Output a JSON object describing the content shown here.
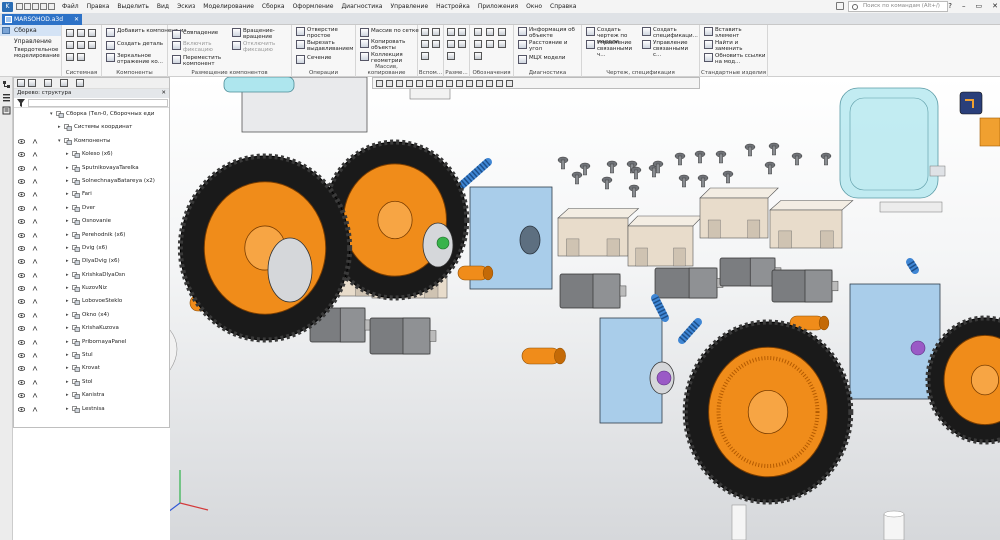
{
  "app": {
    "logo_letter": "K"
  },
  "menu": [
    "Файл",
    "Правка",
    "Выделить",
    "Вид",
    "Эскиз",
    "Моделирование",
    "Сборка",
    "Оформление",
    "Диагностика",
    "Управление",
    "Настройка",
    "Приложения",
    "Окно",
    "Справка"
  ],
  "search": {
    "placeholder": "Поиск по командам (Alt+/)"
  },
  "document_tab": {
    "label": "MARSOHOD.a3d"
  },
  "mode_panel": [
    "Сборка",
    "Управление",
    "Твердотельное моделирование"
  ],
  "ribbon": {
    "groups": [
      {
        "label": "Системная"
      },
      {
        "label": "Компоненты",
        "buttons": [
          "Добавить компонент из...",
          "Создать деталь",
          "Зеркальное отражение ко..."
        ]
      },
      {
        "label": "Размещение компонентов",
        "buttons": [
          "Совпадение",
          "Включить фиксацию",
          "Переместить компонент",
          "Вращение-вращение",
          "Отключить фиксацию"
        ]
      },
      {
        "label": "Операции",
        "buttons": [
          "Отверстие простое",
          "Вырезать выдавливанием",
          "Сечение"
        ]
      },
      {
        "label": "Массив, копирование",
        "buttons": [
          "Массив по сетке",
          "Копировать объекты",
          "Коллекция геометрии"
        ]
      },
      {
        "label": "Вспом..."
      },
      {
        "label": "Разме..."
      },
      {
        "label": "Обозначения"
      },
      {
        "label": "Диагностика",
        "buttons": [
          "Информация об объекте",
          "Расстояние и угол",
          "МЦХ модели"
        ]
      },
      {
        "label": "Чертеж, спецификация",
        "buttons": [
          "Создать чертеж по модели",
          "Управление связанными ч...",
          "Создать спецификаци...",
          "Управление связанными с..."
        ]
      },
      {
        "label": "Стандартные изделия",
        "buttons": [
          "Вставить элемент",
          "Найти и заменить",
          "Обновить ссылки на мод..."
        ]
      }
    ]
  },
  "tree": {
    "title": "Дерево: структура",
    "root": "Сборка (Тел-0, Сборочных еди",
    "coord": "Системы координат",
    "components": "Компоненты",
    "items": [
      "Koleso (x6)",
      "SputnikovayaTarelka",
      "SolnechnayaBatareya (x2)",
      "Fari",
      "Dver",
      "Osnovanie",
      "Perehodnik (x6)",
      "Dvig (x6)",
      "DlyaDvig (x6)",
      "KrishkaDlyaOsn",
      "KuzovNiz",
      "LobovoeSteklo",
      "Okno (x4)",
      "KrishaKuzova",
      "PribornayaPanel",
      "Stul",
      "Krovat",
      "Stol",
      "Kanistra",
      "Lestnisa"
    ]
  },
  "colors": {
    "accent": "#2d72c7",
    "tire": "#1a1a1a",
    "hub": "#f08c1a",
    "block_blue": "#a9cdea",
    "beige": "#e8dccb",
    "motor_grey": "#7b7d80",
    "shock_blue": "#3f86d4",
    "cyan_part": "#aee6ee"
  },
  "icons": [
    "search-icon",
    "eye-icon",
    "lock-icon",
    "filter-icon",
    "close-icon",
    "minimize-icon",
    "maximize-icon",
    "view-cube-icon",
    "axis-triad-icon"
  ]
}
